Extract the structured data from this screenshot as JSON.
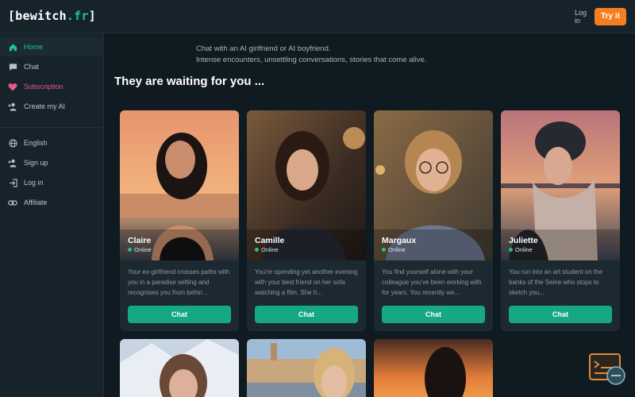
{
  "header": {
    "logo_prefix": "[bewitch",
    "logo_dot": ".fr",
    "logo_suffix": "]",
    "login": "Log in",
    "try_it": "Try it"
  },
  "sidebar": {
    "items": [
      {
        "label": "Home",
        "icon": "home-icon"
      },
      {
        "label": "Chat",
        "icon": "chat-icon"
      },
      {
        "label": "Subscription",
        "icon": "heart-icon"
      },
      {
        "label": "Create my AI",
        "icon": "add-user-icon"
      },
      {
        "label": "English",
        "icon": "globe-icon"
      },
      {
        "label": "Sign up",
        "icon": "add-user-icon"
      },
      {
        "label": "Log in",
        "icon": "login-icon"
      },
      {
        "label": "Affiliate",
        "icon": "link-icon"
      }
    ]
  },
  "main": {
    "intro_line1": "Chat with an AI girlfriend or AI boyfriend.",
    "intro_line2": "Intense encounters, unsettling conversations, stories that come alive.",
    "section_title": "They are waiting for you ...",
    "status_label": "Online",
    "chat_label": "Chat",
    "cards": [
      {
        "name": "Claire",
        "description": "Your ex-girlfriend crosses paths with you in a paradise setting and recognises you from behin..."
      },
      {
        "name": "Camille",
        "description": "You're spending yet another evening with your best friend on her sofa watching a film. She h..."
      },
      {
        "name": "Margaux",
        "description": "You find yourself alone with your colleague you've been working with for years. You recently we..."
      },
      {
        "name": "Juliette",
        "description": "You run into an art student on the banks of the Seine who stops to sketch you..."
      }
    ]
  },
  "colors": {
    "accent": "#1fc48e",
    "try_button": "#f47f20",
    "subscription": "#e8578a",
    "chat_button": "#16a884"
  }
}
